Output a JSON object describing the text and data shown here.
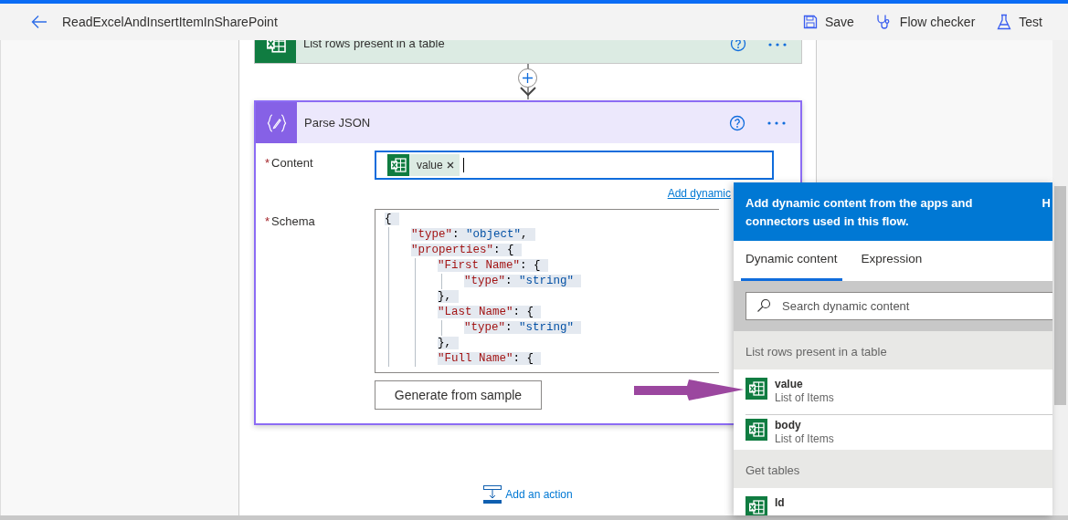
{
  "header": {
    "title": "ReadExcelAndInsertItemInSharePoint",
    "actions": [
      {
        "label": "Save"
      },
      {
        "label": "Flow checker"
      },
      {
        "label": "Test"
      }
    ]
  },
  "list_rows_card": {
    "title": "List rows present in a table"
  },
  "parse_json_card": {
    "title": "Parse JSON",
    "content_field": {
      "label": "Content",
      "required_mark": "*",
      "token": {
        "label": "value"
      }
    },
    "add_dynamic_link": "Add dynamic",
    "schema_field": {
      "label": "Schema",
      "required_mark": "*",
      "lines": [
        {
          "tokens": [
            {
              "text": "{",
              "kind": "punct"
            }
          ],
          "children": [
            {
              "tokens": [
                {
                  "text": "\"type\"",
                  "kind": "key"
                },
                {
                  "text": ": ",
                  "kind": "punct"
                },
                {
                  "text": "\"object\"",
                  "kind": "string"
                },
                {
                  "text": ",",
                  "kind": "punct"
                }
              ]
            },
            {
              "tokens": [
                {
                  "text": "\"properties\"",
                  "kind": "key"
                },
                {
                  "text": ": {",
                  "kind": "punct"
                }
              ],
              "children": [
                {
                  "tokens": [
                    {
                      "text": "\"First Name\"",
                      "kind": "key"
                    },
                    {
                      "text": ": {",
                      "kind": "punct"
                    }
                  ],
                  "children": [
                    {
                      "tokens": [
                        {
                          "text": "\"type\"",
                          "kind": "key"
                        },
                        {
                          "text": ": ",
                          "kind": "punct"
                        },
                        {
                          "text": "\"string\"",
                          "kind": "string"
                        }
                      ]
                    }
                  ]
                },
                {
                  "tokens": [
                    {
                      "text": "},",
                      "kind": "punct"
                    }
                  ]
                },
                {
                  "tokens": [
                    {
                      "text": "\"Last Name\"",
                      "kind": "key"
                    },
                    {
                      "text": ": {",
                      "kind": "punct"
                    }
                  ],
                  "children": [
                    {
                      "tokens": [
                        {
                          "text": "\"type\"",
                          "kind": "key"
                        },
                        {
                          "text": ": ",
                          "kind": "punct"
                        },
                        {
                          "text": "\"string\"",
                          "kind": "string"
                        }
                      ]
                    }
                  ]
                },
                {
                  "tokens": [
                    {
                      "text": "},",
                      "kind": "punct"
                    }
                  ]
                },
                {
                  "tokens": [
                    {
                      "text": "\"Full Name\"",
                      "kind": "key"
                    },
                    {
                      "text": ": {",
                      "kind": "punct"
                    }
                  ]
                }
              ]
            }
          ]
        }
      ]
    },
    "generate_button": "Generate from sample"
  },
  "add_action": "Add an action",
  "dynamic_panel": {
    "header": "Add dynamic content from the apps and connectors used in this flow.",
    "header_cut": "H",
    "tabs": [
      {
        "label": "Dynamic content",
        "selected": true
      },
      {
        "label": "Expression",
        "selected": false
      }
    ],
    "search": {
      "placeholder": "Search dynamic content"
    },
    "sections": [
      {
        "title": "List rows present in a table",
        "items": [
          {
            "name": "value",
            "type": "List of Items"
          },
          {
            "name": "body",
            "type": "List of Items"
          }
        ]
      },
      {
        "title": "Get tables",
        "items": [
          {
            "name": "Id"
          }
        ]
      }
    ]
  }
}
